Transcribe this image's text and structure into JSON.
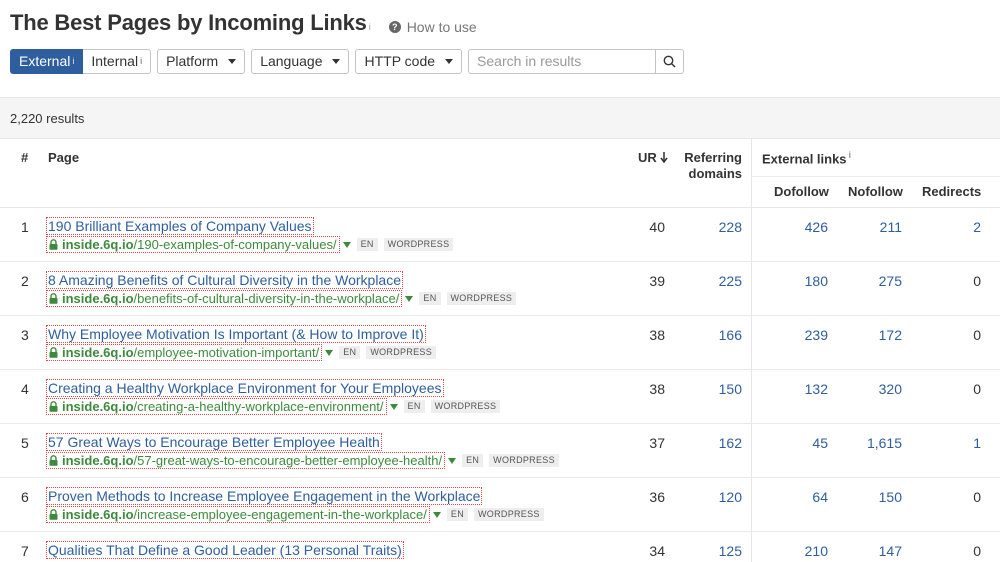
{
  "header": {
    "title": "The Best Pages by Incoming Links",
    "info_marker": "i",
    "howto_label": "How to use",
    "howto_icon": "question-icon"
  },
  "toolbar": {
    "tabs": [
      {
        "label": "External",
        "active": true
      },
      {
        "label": "Internal",
        "active": false
      }
    ],
    "dropdowns": [
      "Platform",
      "Language",
      "HTTP code"
    ],
    "search_placeholder": "Search in results"
  },
  "results": {
    "count_label": "2,220 results"
  },
  "columns": {
    "num": "#",
    "page": "Page",
    "ur": "UR",
    "referring": "Referring",
    "domains": "domains",
    "external_links": "External links",
    "dofollow": "Dofollow",
    "nofollow": "Nofollow",
    "redirects": "Redirects"
  },
  "rows": [
    {
      "n": "1",
      "title": "190 Brilliant Examples of Company Values",
      "domain": "inside.6q.io",
      "path": "/190-examples-of-company-values/",
      "lang": "EN",
      "platform": "WORDPRESS",
      "ur": "40",
      "rd": "228",
      "dofollow": "426",
      "nofollow": "211",
      "redirects": "2"
    },
    {
      "n": "2",
      "title": "8 Amazing Benefits of Cultural Diversity in the Workplace",
      "domain": "inside.6q.io",
      "path": "/benefits-of-cultural-diversity-in-the-workplace/",
      "lang": "EN",
      "platform": "WORDPRESS",
      "ur": "39",
      "rd": "225",
      "dofollow": "180",
      "nofollow": "275",
      "redirects": "0"
    },
    {
      "n": "3",
      "title": "Why Employee Motivation Is Important (& How to Improve It)",
      "domain": "inside.6q.io",
      "path": "/employee-motivation-important/",
      "lang": "EN",
      "platform": "WORDPRESS",
      "ur": "38",
      "rd": "166",
      "dofollow": "239",
      "nofollow": "172",
      "redirects": "0"
    },
    {
      "n": "4",
      "title": "Creating a Healthy Workplace Environment for Your Employees",
      "domain": "inside.6q.io",
      "path": "/creating-a-healthy-workplace-environment/",
      "lang": "EN",
      "platform": "WORDPRESS",
      "ur": "38",
      "rd": "150",
      "dofollow": "132",
      "nofollow": "320",
      "redirects": "0"
    },
    {
      "n": "5",
      "title": "57 Great Ways to Encourage Better Employee Health",
      "domain": "inside.6q.io",
      "path": "/57-great-ways-to-encourage-better-employee-health/",
      "lang": "EN",
      "platform": "WORDPRESS",
      "ur": "37",
      "rd": "162",
      "dofollow": "45",
      "nofollow": "1,615",
      "redirects": "1"
    },
    {
      "n": "6",
      "title": "Proven Methods to Increase Employee Engagement in the Workplace",
      "domain": "inside.6q.io",
      "path": "/increase-employee-engagement-in-the-workplace/",
      "lang": "EN",
      "platform": "WORDPRESS",
      "ur": "36",
      "rd": "120",
      "dofollow": "64",
      "nofollow": "150",
      "redirects": "0"
    },
    {
      "n": "7",
      "title": "Qualities That Define a Good Leader (13 Personal Traits)",
      "domain": "",
      "path": "",
      "lang": "",
      "platform": "",
      "ur": "34",
      "rd": "125",
      "dofollow": "210",
      "nofollow": "147",
      "redirects": "0"
    }
  ]
}
